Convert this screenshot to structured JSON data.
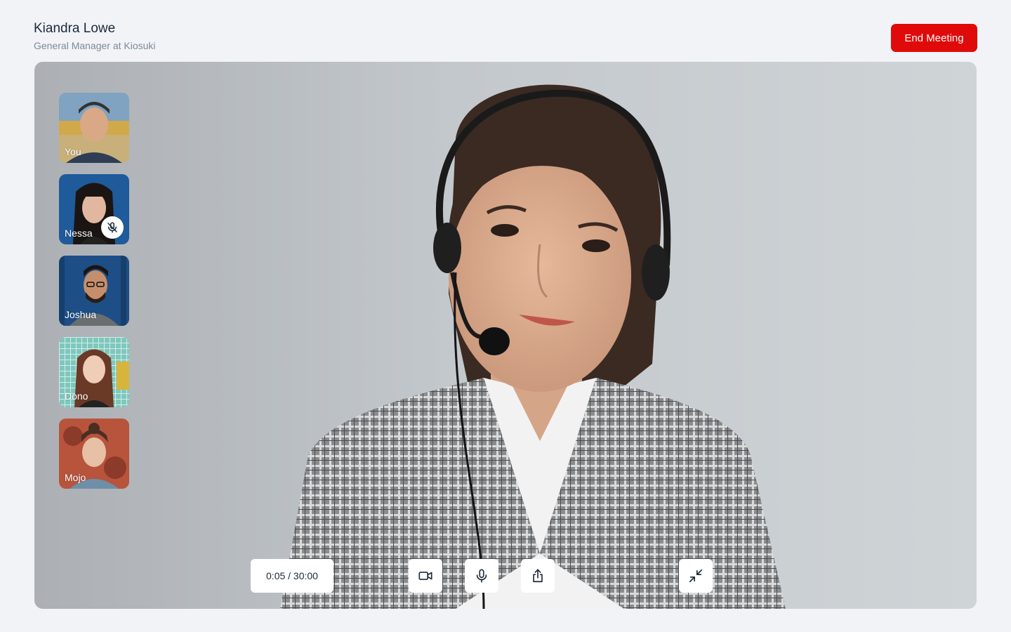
{
  "header": {
    "host_name": "Kiandra Lowe",
    "host_role": "General Manager at Kiosuki",
    "end_meeting_label": "End Meeting"
  },
  "participants": [
    {
      "name": "You",
      "muted": false
    },
    {
      "name": "Nessa",
      "muted": true
    },
    {
      "name": "Joshua",
      "muted": false
    },
    {
      "name": "Dono",
      "muted": false
    },
    {
      "name": "Mojo",
      "muted": false
    }
  ],
  "controls": {
    "timer": "0:05 / 30:00",
    "icons": [
      "video-camera-icon",
      "microphone-icon",
      "share-icon",
      "minimize-icon"
    ]
  },
  "colors": {
    "accent": "#e00a0a",
    "background": "#f1f3f7",
    "text": "#1b2a3a",
    "muted_text": "#7d8b99"
  }
}
